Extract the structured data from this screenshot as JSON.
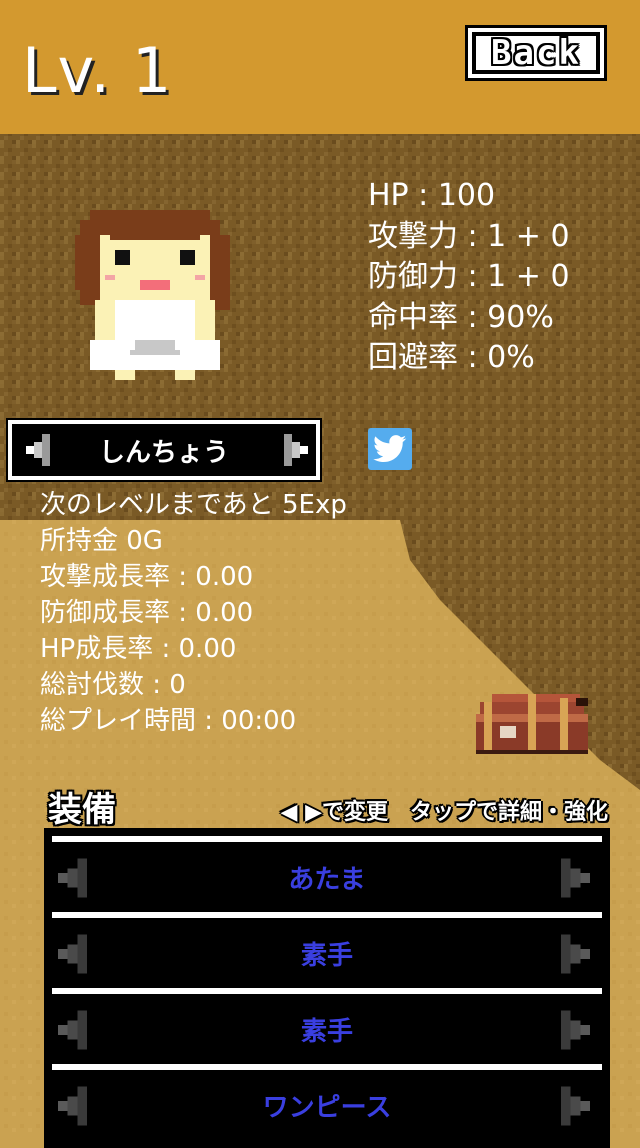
{
  "header": {
    "level_text": "Lv. 1",
    "back_label": "Back"
  },
  "stats": {
    "hp": "HP : 100",
    "attack": "攻撃力 : 1 + 0",
    "defense": "防御力 : 1 + 0",
    "accuracy": "命中率 : 90%",
    "evasion": "回避率 : 0%"
  },
  "character": {
    "name": "しんちょう"
  },
  "info": {
    "next_level": "次のレベルまであと 5Exp",
    "money": "所持金 0G",
    "attack_growth": "攻撃成長率 : 0.00",
    "defense_growth": "防御成長率 : 0.00",
    "hp_growth": "HP成長率 : 0.00",
    "total_kills": "総討伐数 : 0",
    "total_playtime": "総プレイ時間 : 00:00"
  },
  "equipment": {
    "title": "装備",
    "hint": "◀ ▶で変更　タップで詳細・強化",
    "slots": [
      {
        "label": "あたま"
      },
      {
        "label": "素手"
      },
      {
        "label": "素手"
      },
      {
        "label": "ワンピース"
      }
    ]
  },
  "colors": {
    "header_bg": "#d3992f",
    "sand": "#caa251",
    "dirt": "#7a5a26",
    "slot_text": "#3a3fe0",
    "twitter": "#55acee"
  },
  "icons": {
    "twitter": "twitter-bird-icon",
    "chest": "treasure-chest-icon"
  }
}
